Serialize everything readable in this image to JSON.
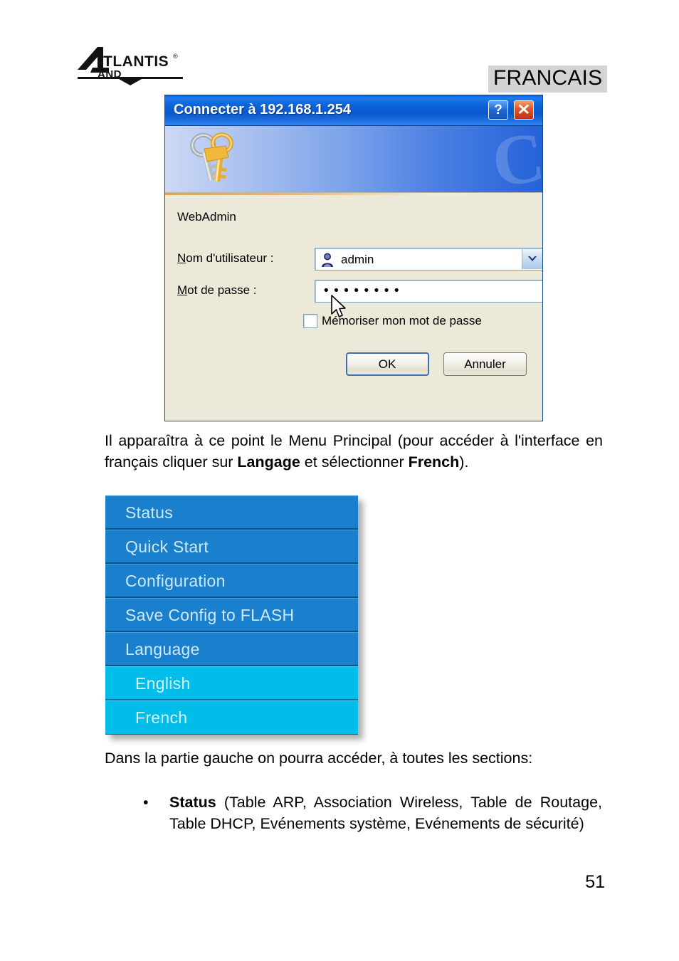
{
  "header": {
    "logo_primary": "ATLANTIS",
    "logo_secondary": "LAND",
    "logo_trademark": "®",
    "language_banner": "FRANCAIS"
  },
  "login_dialog": {
    "title": "Connecter à 192.168.1.254",
    "help_button": "?",
    "close_button": "✕",
    "realm": "WebAdmin",
    "username_label": "Nom d'utilisateur :",
    "username_label_accel": "N",
    "username_label_rest": "om d'utilisateur :",
    "username_value": "admin",
    "password_label": "Mot de passe :",
    "password_label_accel": "M",
    "password_label_rest": "ot de passe :",
    "password_value": "••••••••",
    "remember_label": "Mémoriser mon mot de passe",
    "remember_checked": false,
    "ok_label": "OK",
    "cancel_label": "Annuler",
    "banner_watermark": "C"
  },
  "body_text": {
    "paragraph1_part1": "Il apparaîtra à ce point le Menu Principal (pour accéder à l'interface en français cliquer sur ",
    "paragraph1_bold1": "Langage",
    "paragraph1_part2": " et sélectionner ",
    "paragraph1_bold2": "French",
    "paragraph1_part3": ").",
    "paragraph2": "Dans la partie gauche on pourra accéder, à toutes les sections:"
  },
  "router_menu": {
    "items": [
      {
        "label": "Status",
        "sub": false
      },
      {
        "label": "Quick Start",
        "sub": false
      },
      {
        "label": "Configuration",
        "sub": false
      },
      {
        "label": "Save Config to FLASH",
        "sub": false
      },
      {
        "label": "Language",
        "sub": false
      },
      {
        "label": "English",
        "sub": true
      },
      {
        "label": "French",
        "sub": true
      }
    ]
  },
  "bullets": [
    {
      "marker": "•",
      "bold": "Status",
      "text": " (Table ARP, Association Wireless, Table de Routage, Table DHCP, Evénements système, Evénements de sécurité)"
    }
  ],
  "footer": {
    "page_number": "51"
  },
  "colors": {
    "menu_primary": "#1a7fcc",
    "menu_sub": "#00bdea",
    "titlebar_blue": "#0d62d9",
    "close_red": "#e0522a",
    "banner_highlight": "#d4d4d4"
  }
}
